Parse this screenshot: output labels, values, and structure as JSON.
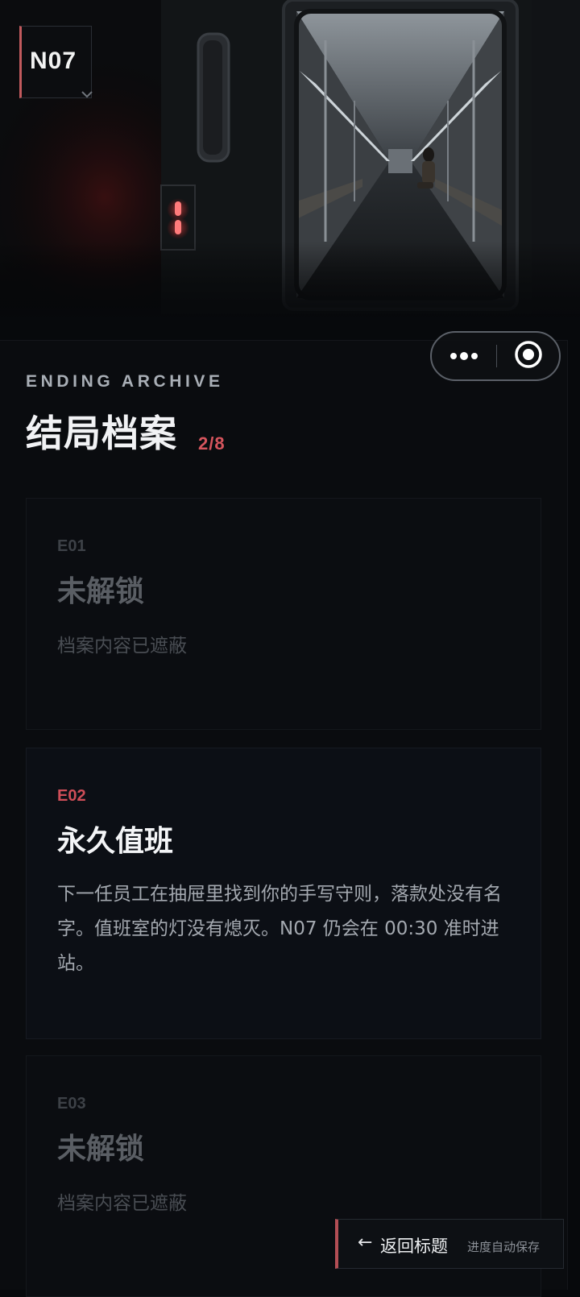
{
  "hero": {
    "line_code": "N07"
  },
  "capsule": {
    "more_icon": "more-dots-icon",
    "close_icon": "target-circle-icon"
  },
  "archive": {
    "eyebrow": "ENDING ARCHIVE",
    "title": "结局档案",
    "count": "2/8"
  },
  "endings": [
    {
      "code": "E01",
      "name": "未解锁",
      "desc": "档案内容已遮蔽",
      "unlocked": false
    },
    {
      "code": "E02",
      "name": "永久值班",
      "desc": "下一任员工在抽屉里找到你的手写守则，落款处没有名字。值班室的灯没有熄灭。N07 仍会在 00:30 准时进站。",
      "unlocked": true
    },
    {
      "code": "E03",
      "name": "未解锁",
      "desc": "档案内容已遮蔽",
      "unlocked": false
    }
  ],
  "footer": {
    "back_label": "返回标题",
    "autosave_hint": "进度自动保存",
    "back_icon": "arrow-left-icon"
  },
  "colors": {
    "accent": "#d6555d",
    "background": "#07090c",
    "card": "#0c0f15"
  }
}
